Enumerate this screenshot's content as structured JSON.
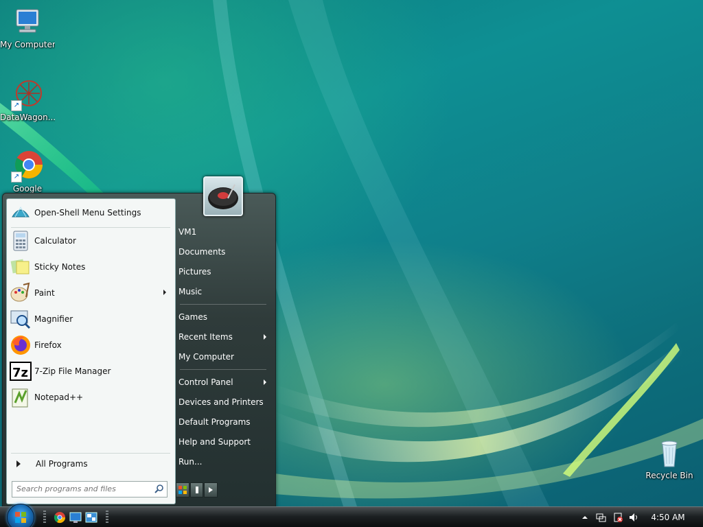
{
  "desktop": {
    "icons": [
      {
        "label": "My Computer"
      },
      {
        "label": "DataWagon..."
      },
      {
        "label": "Google"
      },
      {
        "label": "Recycle Bin"
      }
    ]
  },
  "start_menu": {
    "programs": [
      {
        "label": "Open-Shell Menu Settings",
        "icon": "open-shell-icon"
      },
      {
        "label": "Calculator",
        "icon": "calculator-icon"
      },
      {
        "label": "Sticky Notes",
        "icon": "sticky-notes-icon"
      },
      {
        "label": "Paint",
        "icon": "paint-icon",
        "submenu": true
      },
      {
        "label": "Magnifier",
        "icon": "magnifier-icon"
      },
      {
        "label": "Firefox",
        "icon": "firefox-icon"
      },
      {
        "label": "7-Zip File Manager",
        "icon": "7zip-icon"
      },
      {
        "label": "Notepad++",
        "icon": "notepadpp-icon"
      }
    ],
    "all_programs": "All Programs",
    "search_placeholder": "Search programs and files",
    "right_items": [
      {
        "label": "VM1"
      },
      {
        "label": "Documents"
      },
      {
        "label": "Pictures"
      },
      {
        "label": "Music"
      },
      {
        "label": "Games"
      },
      {
        "label": "Recent Items",
        "submenu": true
      },
      {
        "label": "My Computer"
      },
      {
        "label": "Control Panel",
        "submenu": true
      },
      {
        "label": "Devices and Printers"
      },
      {
        "label": "Default Programs"
      },
      {
        "label": "Help and Support"
      },
      {
        "label": "Run..."
      }
    ]
  },
  "taskbar": {
    "clock": "4:50 AM"
  }
}
